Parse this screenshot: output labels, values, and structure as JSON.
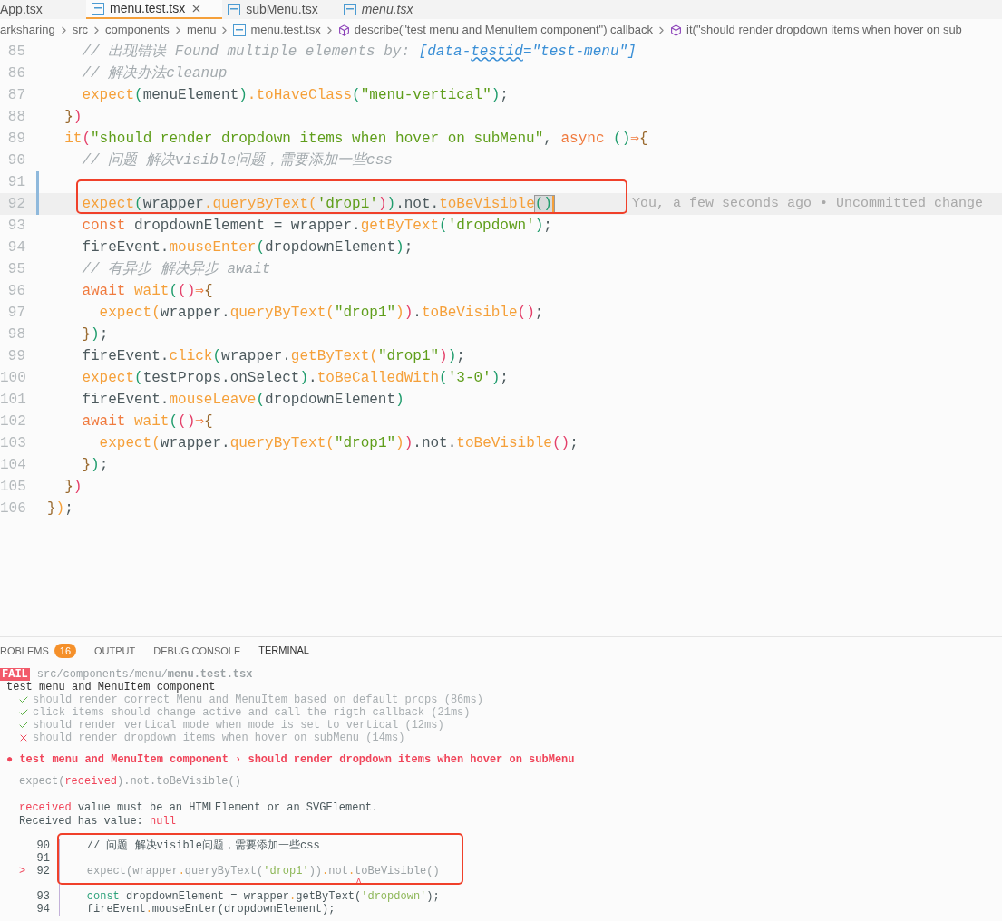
{
  "tabs": [
    {
      "label": "App.tsx",
      "selected": false,
      "preview": false,
      "has_icon": false
    },
    {
      "label": "menu.test.tsx",
      "selected": true,
      "preview": false,
      "has_icon": true
    },
    {
      "label": "subMenu.tsx",
      "selected": false,
      "preview": false,
      "has_icon": true
    },
    {
      "label": "menu.tsx",
      "selected": false,
      "preview": true,
      "has_icon": true
    }
  ],
  "breadcrumb": [
    {
      "kind": "folder",
      "label": "arksharing"
    },
    {
      "kind": "folder",
      "label": "src"
    },
    {
      "kind": "folder",
      "label": "components"
    },
    {
      "kind": "folder",
      "label": "menu"
    },
    {
      "kind": "file",
      "label": "menu.test.tsx"
    },
    {
      "kind": "symbol",
      "label": "describe(\"test menu and MenuItem component\") callback"
    },
    {
      "kind": "symbol",
      "label": "it(\"should render dropdown items when hover on sub"
    }
  ],
  "editor": {
    "blame": "You, a few seconds ago • Uncommitted change",
    "lines": [
      {
        "number": "85",
        "modified": false,
        "current": false,
        "tokens": [
          {
            "text": "    // 出现错误 Found multiple elements by: ",
            "kind": "comment"
          },
          {
            "text": "[data-",
            "kind": "attr"
          },
          {
            "text": "testid",
            "kind": "attr",
            "warning": true
          },
          {
            "text": "=\"test-menu\"]",
            "kind": "attr"
          }
        ]
      },
      {
        "number": "86",
        "modified": false,
        "current": false,
        "tokens": [
          {
            "text": "    // 解决办法cleanup",
            "kind": "comment"
          }
        ]
      },
      {
        "number": "87",
        "modified": false,
        "current": false,
        "tokens": [
          {
            "text": "    expect",
            "kind": "method"
          },
          {
            "text": "(",
            "kind": "green"
          },
          {
            "text": "menuElement",
            "kind": "plain"
          },
          {
            "text": ")",
            "kind": "green"
          },
          {
            "text": ".",
            "kind": "method"
          },
          {
            "text": "toHaveClass",
            "kind": "method"
          },
          {
            "text": "(",
            "kind": "green"
          },
          {
            "text": "\"menu-vertical\"",
            "kind": "string"
          },
          {
            "text": ")",
            "kind": "green"
          },
          {
            "text": ";",
            "kind": "plain"
          }
        ]
      },
      {
        "number": "88",
        "modified": false,
        "current": false,
        "tokens": [
          {
            "text": "  }",
            "kind": "brown"
          },
          {
            "text": ")",
            "kind": "red"
          }
        ]
      },
      {
        "number": "89",
        "modified": false,
        "current": false,
        "tokens": [
          {
            "text": "  it",
            "kind": "method"
          },
          {
            "text": "(",
            "kind": "red"
          },
          {
            "text": "\"should render dropdown items when hover on subMenu\"",
            "kind": "string"
          },
          {
            "text": ", ",
            "kind": "plain"
          },
          {
            "text": "async ",
            "kind": "keyword"
          },
          {
            "text": "()",
            "kind": "green"
          },
          {
            "text": "⇒",
            "kind": "keyword"
          },
          {
            "text": "{",
            "kind": "brown"
          }
        ]
      },
      {
        "number": "90",
        "modified": false,
        "current": false,
        "tokens": [
          {
            "text": "    // 问题 解决visible问题，需要添加一些css",
            "kind": "comment"
          }
        ]
      },
      {
        "number": "91",
        "modified": true,
        "current": false
      },
      {
        "number": "92",
        "modified": true,
        "current": true,
        "tokens": [
          {
            "text": "    expect",
            "kind": "method"
          },
          {
            "text": "(",
            "kind": "green"
          },
          {
            "text": "wrapper",
            "kind": "plain"
          },
          {
            "text": ".",
            "kind": "method"
          },
          {
            "text": "queryByText",
            "kind": "method"
          },
          {
            "text": "(",
            "kind": "orange"
          },
          {
            "text": "'drop1'",
            "kind": "string"
          },
          {
            "text": ")",
            "kind": "red"
          },
          {
            "text": ")",
            "kind": "green"
          },
          {
            "text": ".not.",
            "kind": "plain"
          },
          {
            "text": "toBeVisible",
            "kind": "method"
          },
          {
            "text": "()",
            "kind": "green",
            "matched": true
          }
        ]
      },
      {
        "number": "93",
        "modified": false,
        "current": false,
        "tokens": [
          {
            "text": "    const ",
            "kind": "keyword"
          },
          {
            "text": "dropdownElement = wrapper.",
            "kind": "plain"
          },
          {
            "text": "getByText",
            "kind": "method"
          },
          {
            "text": "(",
            "kind": "green"
          },
          {
            "text": "'dropdown'",
            "kind": "string"
          },
          {
            "text": ")",
            "kind": "green"
          },
          {
            "text": ";",
            "kind": "plain"
          }
        ]
      },
      {
        "number": "94",
        "modified": false,
        "current": false,
        "tokens": [
          {
            "text": "    fireEvent.",
            "kind": "plain"
          },
          {
            "text": "mouseEnter",
            "kind": "method"
          },
          {
            "text": "(",
            "kind": "green"
          },
          {
            "text": "dropdownElement",
            "kind": "plain"
          },
          {
            "text": ")",
            "kind": "green"
          },
          {
            "text": ";",
            "kind": "plain"
          }
        ]
      },
      {
        "number": "95",
        "modified": false,
        "current": false,
        "tokens": [
          {
            "text": "    // 有异步 解决异步 await",
            "kind": "comment"
          }
        ]
      },
      {
        "number": "96",
        "modified": false,
        "current": false,
        "tokens": [
          {
            "text": "    await ",
            "kind": "keyword"
          },
          {
            "text": "wait",
            "kind": "method"
          },
          {
            "text": "(",
            "kind": "green"
          },
          {
            "text": "()",
            "kind": "red"
          },
          {
            "text": "⇒",
            "kind": "keyword"
          },
          {
            "text": "{",
            "kind": "brown"
          }
        ]
      },
      {
        "number": "97",
        "modified": false,
        "current": false,
        "tokens": [
          {
            "text": "      expect",
            "kind": "method"
          },
          {
            "text": "(",
            "kind": "orange"
          },
          {
            "text": "wrapper.",
            "kind": "plain"
          },
          {
            "text": "queryByText",
            "kind": "method"
          },
          {
            "text": "(",
            "kind": "orange"
          },
          {
            "text": "\"drop1\"",
            "kind": "string"
          },
          {
            "text": ")",
            "kind": "orange"
          },
          {
            "text": ")",
            "kind": "red"
          },
          {
            "text": ".",
            "kind": "plain"
          },
          {
            "text": "toBeVisible",
            "kind": "method"
          },
          {
            "text": "()",
            "kind": "red"
          },
          {
            "text": ";",
            "kind": "plain"
          }
        ]
      },
      {
        "number": "98",
        "modified": false,
        "current": false,
        "tokens": [
          {
            "text": "    }",
            "kind": "brown"
          },
          {
            "text": ")",
            "kind": "green"
          },
          {
            "text": ";",
            "kind": "plain"
          }
        ]
      },
      {
        "number": "99",
        "modified": false,
        "current": false,
        "tokens": [
          {
            "text": "    fireEvent.",
            "kind": "plain"
          },
          {
            "text": "click",
            "kind": "method"
          },
          {
            "text": "(",
            "kind": "green"
          },
          {
            "text": "wrapper.",
            "kind": "plain"
          },
          {
            "text": "getByText",
            "kind": "method"
          },
          {
            "text": "(",
            "kind": "orange"
          },
          {
            "text": "\"drop1\"",
            "kind": "string"
          },
          {
            "text": ")",
            "kind": "red"
          },
          {
            "text": ")",
            "kind": "green"
          },
          {
            "text": ";",
            "kind": "plain"
          }
        ]
      },
      {
        "number": "100",
        "modified": false,
        "current": false,
        "tokens": [
          {
            "text": "    expect",
            "kind": "method"
          },
          {
            "text": "(",
            "kind": "green"
          },
          {
            "text": "testProps.onSelect",
            "kind": "plain"
          },
          {
            "text": ")",
            "kind": "green"
          },
          {
            "text": ".",
            "kind": "plain"
          },
          {
            "text": "toBeCalledWith",
            "kind": "method"
          },
          {
            "text": "(",
            "kind": "green"
          },
          {
            "text": "'3-0'",
            "kind": "string"
          },
          {
            "text": ")",
            "kind": "green"
          },
          {
            "text": ";",
            "kind": "plain"
          }
        ]
      },
      {
        "number": "101",
        "modified": false,
        "current": false,
        "tokens": [
          {
            "text": "    fireEvent.",
            "kind": "plain"
          },
          {
            "text": "mouseLeave",
            "kind": "method"
          },
          {
            "text": "(",
            "kind": "green"
          },
          {
            "text": "dropdownElement",
            "kind": "plain"
          },
          {
            "text": ")",
            "kind": "green"
          }
        ]
      },
      {
        "number": "102",
        "modified": false,
        "current": false,
        "tokens": [
          {
            "text": "    await ",
            "kind": "keyword"
          },
          {
            "text": "wait",
            "kind": "method"
          },
          {
            "text": "(",
            "kind": "green"
          },
          {
            "text": "()",
            "kind": "red"
          },
          {
            "text": "⇒",
            "kind": "keyword"
          },
          {
            "text": "{",
            "kind": "brown"
          }
        ]
      },
      {
        "number": "103",
        "modified": false,
        "current": false,
        "tokens": [
          {
            "text": "      expect",
            "kind": "method"
          },
          {
            "text": "(",
            "kind": "orange"
          },
          {
            "text": "wrapper.",
            "kind": "plain"
          },
          {
            "text": "queryByText",
            "kind": "method"
          },
          {
            "text": "(",
            "kind": "orange"
          },
          {
            "text": "\"drop1\"",
            "kind": "string"
          },
          {
            "text": ")",
            "kind": "orange"
          },
          {
            "text": ")",
            "kind": "red"
          },
          {
            "text": ".not.",
            "kind": "plain"
          },
          {
            "text": "toBeVisible",
            "kind": "method"
          },
          {
            "text": "()",
            "kind": "red"
          },
          {
            "text": ";",
            "kind": "plain"
          }
        ]
      },
      {
        "number": "104",
        "modified": false,
        "current": false,
        "tokens": [
          {
            "text": "    }",
            "kind": "brown"
          },
          {
            "text": ")",
            "kind": "green"
          },
          {
            "text": ";",
            "kind": "plain"
          }
        ]
      },
      {
        "number": "105",
        "modified": false,
        "current": false,
        "tokens": [
          {
            "text": "  }",
            "kind": "brown"
          },
          {
            "text": ")",
            "kind": "red"
          }
        ]
      },
      {
        "number": "106",
        "modified": false,
        "current": false,
        "tokens": [
          {
            "text": "}",
            "kind": "brown"
          },
          {
            "text": ")",
            "kind": "orange"
          },
          {
            "text": ";",
            "kind": "plain"
          }
        ]
      }
    ]
  },
  "panel": {
    "tabs": [
      {
        "label": "ROBLEMS",
        "badge": "16",
        "selected": false
      },
      {
        "label": "OUTPUT",
        "selected": false
      },
      {
        "label": "DEBUG CONSOLE",
        "selected": false
      },
      {
        "label": "TERMINAL",
        "selected": true
      }
    ],
    "terminal": {
      "status": "FAIL",
      "path": "src/components/menu/**menu.test.tsx**",
      "suite": "test menu and MenuItem component",
      "results": [
        {
          "passed": true,
          "text": "should render correct Menu and MenuItem based on default props (86ms)"
        },
        {
          "passed": true,
          "text": "click items should change active and call the rigth callback (21ms)"
        },
        {
          "passed": true,
          "text": "should render vertical mode when mode is set to vertical (12ms)"
        },
        {
          "passed": false,
          "text": "should render dropdown items when hover on subMenu (14ms)"
        }
      ],
      "error_title": "● test menu and MenuItem component › should render dropdown items when hover on subMenu",
      "messages": [
        [
          {
            "text": "expect(",
            "kind": "dim"
          },
          {
            "text": "received",
            "kind": "error"
          },
          {
            "text": ").not.toBeVisible()",
            "kind": "dim"
          }
        ],
        [
          {
            "text": "received",
            "kind": "error"
          },
          {
            "text": " value must be an HTMLElement or an SVGElement.",
            "kind": "plain"
          }
        ],
        [
          {
            "text": "Received has value: ",
            "kind": "plain"
          },
          {
            "text": "null",
            "kind": "error"
          }
        ]
      ],
      "frame": [
        {
          "kind": "code",
          "number": "90",
          "tokens": [
            {
              "text": "    // 问题 解决visible问题，需要添加一些css",
              "kind": "plain"
            }
          ]
        },
        {
          "kind": "code",
          "number": "91"
        },
        {
          "kind": "code",
          "number": "92",
          "marker": ">",
          "tokens": [
            {
              "text": "    expect(wrapper",
              "kind": "dim"
            },
            {
              "text": ".",
              "kind": "dot"
            },
            {
              "text": "queryByText(",
              "kind": "dim"
            },
            {
              "text": "'drop1'",
              "kind": "string"
            },
            {
              "text": "))",
              "kind": "dim"
            },
            {
              "text": ".",
              "kind": "dot"
            },
            {
              "text": "not",
              "kind": "dim"
            },
            {
              "text": ".",
              "kind": "dot"
            },
            {
              "text": "toBeVisible()",
              "kind": "dim"
            }
          ]
        },
        {
          "kind": "caret",
          "text": "^"
        },
        {
          "kind": "code",
          "number": "93",
          "tokens": [
            {
              "text": "    const ",
              "kind": "keyword"
            },
            {
              "text": "dropdownElement = wrapper",
              "kind": "plain"
            },
            {
              "text": ".",
              "kind": "dot"
            },
            {
              "text": "getByText(",
              "kind": "plain"
            },
            {
              "text": "'dropdown'",
              "kind": "string"
            },
            {
              "text": ");",
              "kind": "plain"
            }
          ]
        },
        {
          "kind": "code",
          "number": "94",
          "tokens": [
            {
              "text": "    fireEvent",
              "kind": "plain"
            },
            {
              "text": ".",
              "kind": "dot"
            },
            {
              "text": "mouseEnter(dropdownElement);",
              "kind": "plain"
            }
          ]
        }
      ]
    }
  }
}
